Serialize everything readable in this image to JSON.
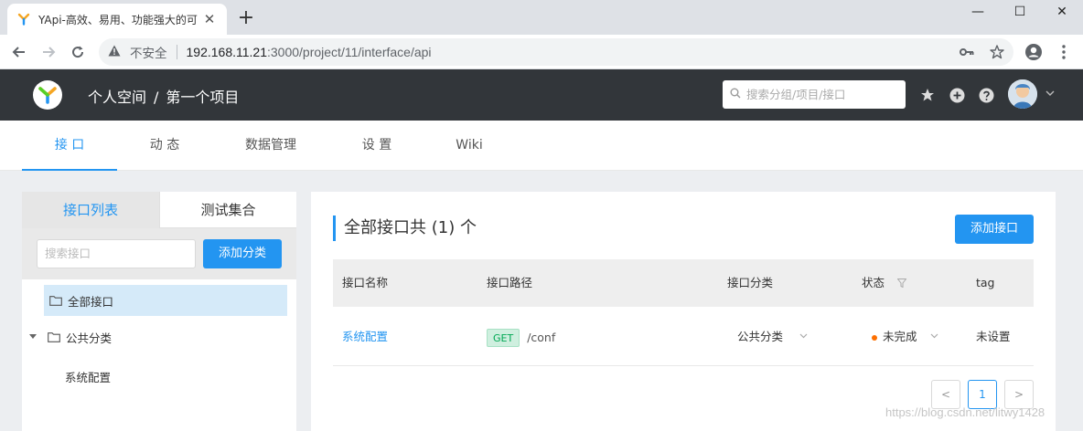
{
  "browser": {
    "tab_title": "YApi-高效、易用、功能强大的可",
    "close_glyph": "✕",
    "new_tab_glyph": "+",
    "window_controls": [
      "—",
      "☐",
      "✕"
    ],
    "security_label": "不安全",
    "url_host": "192.168.11.21",
    "url_rest": ":3000/project/11/interface/api"
  },
  "header": {
    "breadcrumb_space": "个人空间",
    "breadcrumb_sep": "/",
    "breadcrumb_project": "第一个项目",
    "search_placeholder": "搜索分组/项目/接口",
    "bg_color": "#32363a"
  },
  "subnav": {
    "tabs": [
      {
        "label": "接 口",
        "active": true
      },
      {
        "label": "动 态",
        "active": false
      },
      {
        "label": "数据管理",
        "active": false
      },
      {
        "label": "设 置",
        "active": false
      },
      {
        "label": "Wiki",
        "active": false
      }
    ]
  },
  "sidebar": {
    "tab_list": "接口列表",
    "tab_collection": "测试集合",
    "search_placeholder": "搜索接口",
    "add_category_label": "添加分类",
    "tree": {
      "all_label": "全部接口",
      "category_label": "公共分类",
      "leaf_label": "系统配置"
    }
  },
  "main": {
    "title": "全部接口共 (1) 个",
    "add_interface_label": "添加接口",
    "columns": [
      "接口名称",
      "接口路径",
      "接口分类",
      "状态",
      "tag"
    ],
    "rows": [
      {
        "name": "系统配置",
        "method": "GET",
        "path": "/conf",
        "category": "公共分类",
        "status": "未完成",
        "tag": "未设置"
      }
    ],
    "pagination": {
      "prev": "<",
      "current": "1",
      "next": ">"
    }
  },
  "watermark": "https://blog.csdn.net/litwy1428",
  "colors": {
    "accent": "#2395f1",
    "status_dot": "#fd6f00",
    "get_green": "#00a854"
  }
}
